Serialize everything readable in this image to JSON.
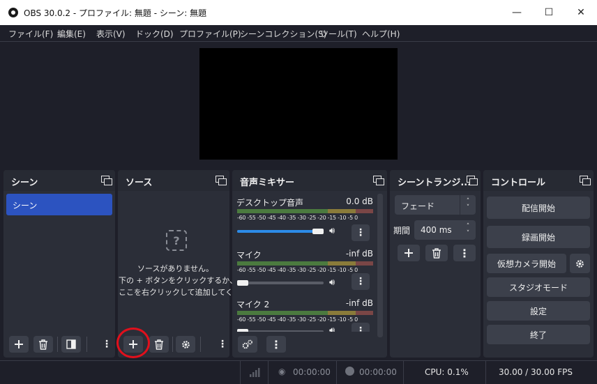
{
  "window": {
    "title": "OBS 30.0.2 - プロファイル: 無題 - シーン: 無題",
    "minimize": "—",
    "maximize": "☐",
    "close": "✕"
  },
  "menu": [
    "ファイル(F)",
    "編集(E)",
    "表示(V)",
    "ドック(D)",
    "プロファイル(P)",
    "シーンコレクション(S)",
    "ツール(T)",
    "ヘルプ(H)"
  ],
  "docks": {
    "scenes": {
      "title": "シーン",
      "items": [
        "シーン"
      ]
    },
    "sources": {
      "title": "ソース",
      "empty_line1": "ソースがありません。",
      "empty_line2": "下の + ボタンをクリックするか、",
      "empty_line3": "ここを右クリックして追加してください。"
    },
    "mixer": {
      "title": "音声ミキサー",
      "scale": "-60 -55 -50 -45 -40 -35 -30 -25 -20 -15 -10 -5 0",
      "channels": [
        {
          "name": "デスクトップ音声",
          "db": "0.0 dB",
          "volume": 1.0
        },
        {
          "name": "マイク",
          "db": "-inf dB",
          "volume": 0.0
        },
        {
          "name": "マイク 2",
          "db": "-inf dB",
          "volume": 0.0
        }
      ]
    },
    "transitions": {
      "title": "シーントランジ...",
      "selected": "フェード",
      "duration_label": "期間",
      "duration_value": "400 ms"
    },
    "controls": {
      "title": "コントロール",
      "start_streaming": "配信開始",
      "start_recording": "録画開始",
      "start_virtual_camera": "仮想カメラ開始",
      "studio_mode": "スタジオモード",
      "settings": "設定",
      "exit": "終了"
    }
  },
  "status": {
    "stream_time": "00:00:00",
    "record_time": "00:00:00",
    "cpu": "CPU: 0.1%",
    "fps": "30.00 / 30.00 FPS"
  },
  "colors": {
    "accent": "#2c53c0",
    "highlight": "#e0101c",
    "background": "#1e1f29",
    "dock": "#2b2e38"
  }
}
